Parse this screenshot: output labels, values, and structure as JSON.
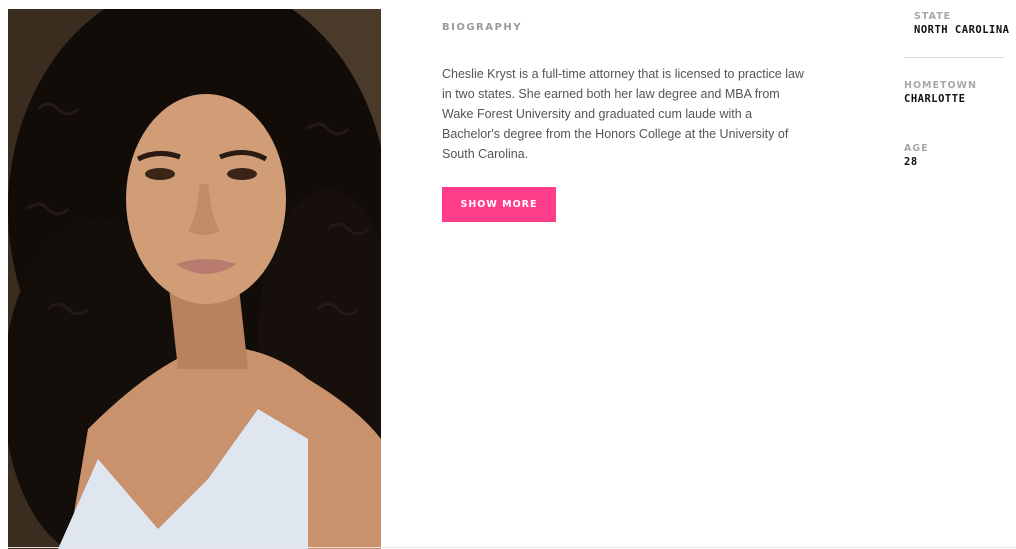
{
  "biography": {
    "heading": "BIOGRAPHY",
    "text": "Cheslie Kryst is a full-time attorney that is licensed to practice law in two states. She earned both her law degree and MBA from Wake Forest University and graduated cum laude with a Bachelor's degree from the Honors College at the University of South Carolina.",
    "button_label": "SHOW MORE"
  },
  "stats": {
    "state_label": "STATE",
    "state_value": "NORTH CAROLINA",
    "hometown_label": "HOMETOWN",
    "hometown_value": "CHARLOTTE",
    "age_label": "AGE",
    "age_value": "28"
  },
  "colors": {
    "accent": "#ff3d8b",
    "label": "#a8a8a8",
    "text": "#555555"
  },
  "icons": {
    "photo": "portrait-photo"
  }
}
